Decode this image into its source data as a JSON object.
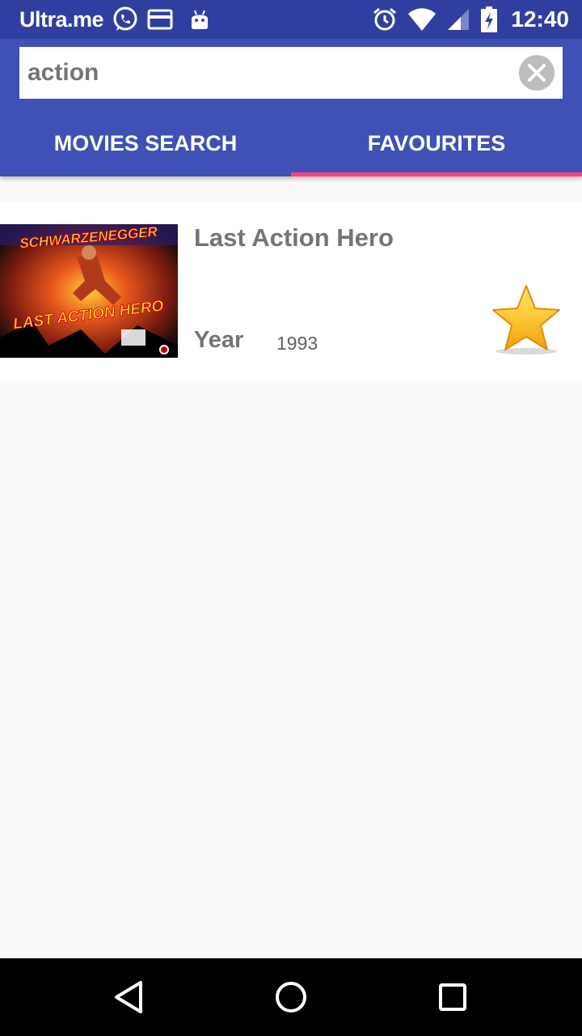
{
  "status_bar": {
    "carrier": "Ultra.me",
    "time": "12:40",
    "icons": [
      "whatsapp-icon",
      "card-icon",
      "android-icon",
      "alarm-icon",
      "wifi-icon",
      "signal-icon",
      "battery-charging-icon"
    ]
  },
  "search": {
    "value": "action",
    "placeholder": ""
  },
  "tabs": [
    {
      "label": "MOVIES SEARCH",
      "selected": false
    },
    {
      "label": "FAVOURITES",
      "selected": true
    }
  ],
  "movies": [
    {
      "title": "Last Action Hero",
      "year_label": "Year",
      "year": "1993",
      "poster_text_top": "SCHWARZENEGGER",
      "poster_text_main": "LAST ACTION HERO",
      "favourite": true
    }
  ],
  "colors": {
    "status_bar": "#303f9f",
    "primary": "#3f51b5",
    "accent": "#ff4081",
    "star": "#fbc02d"
  },
  "nav": [
    "back-icon",
    "home-icon",
    "recents-icon"
  ]
}
